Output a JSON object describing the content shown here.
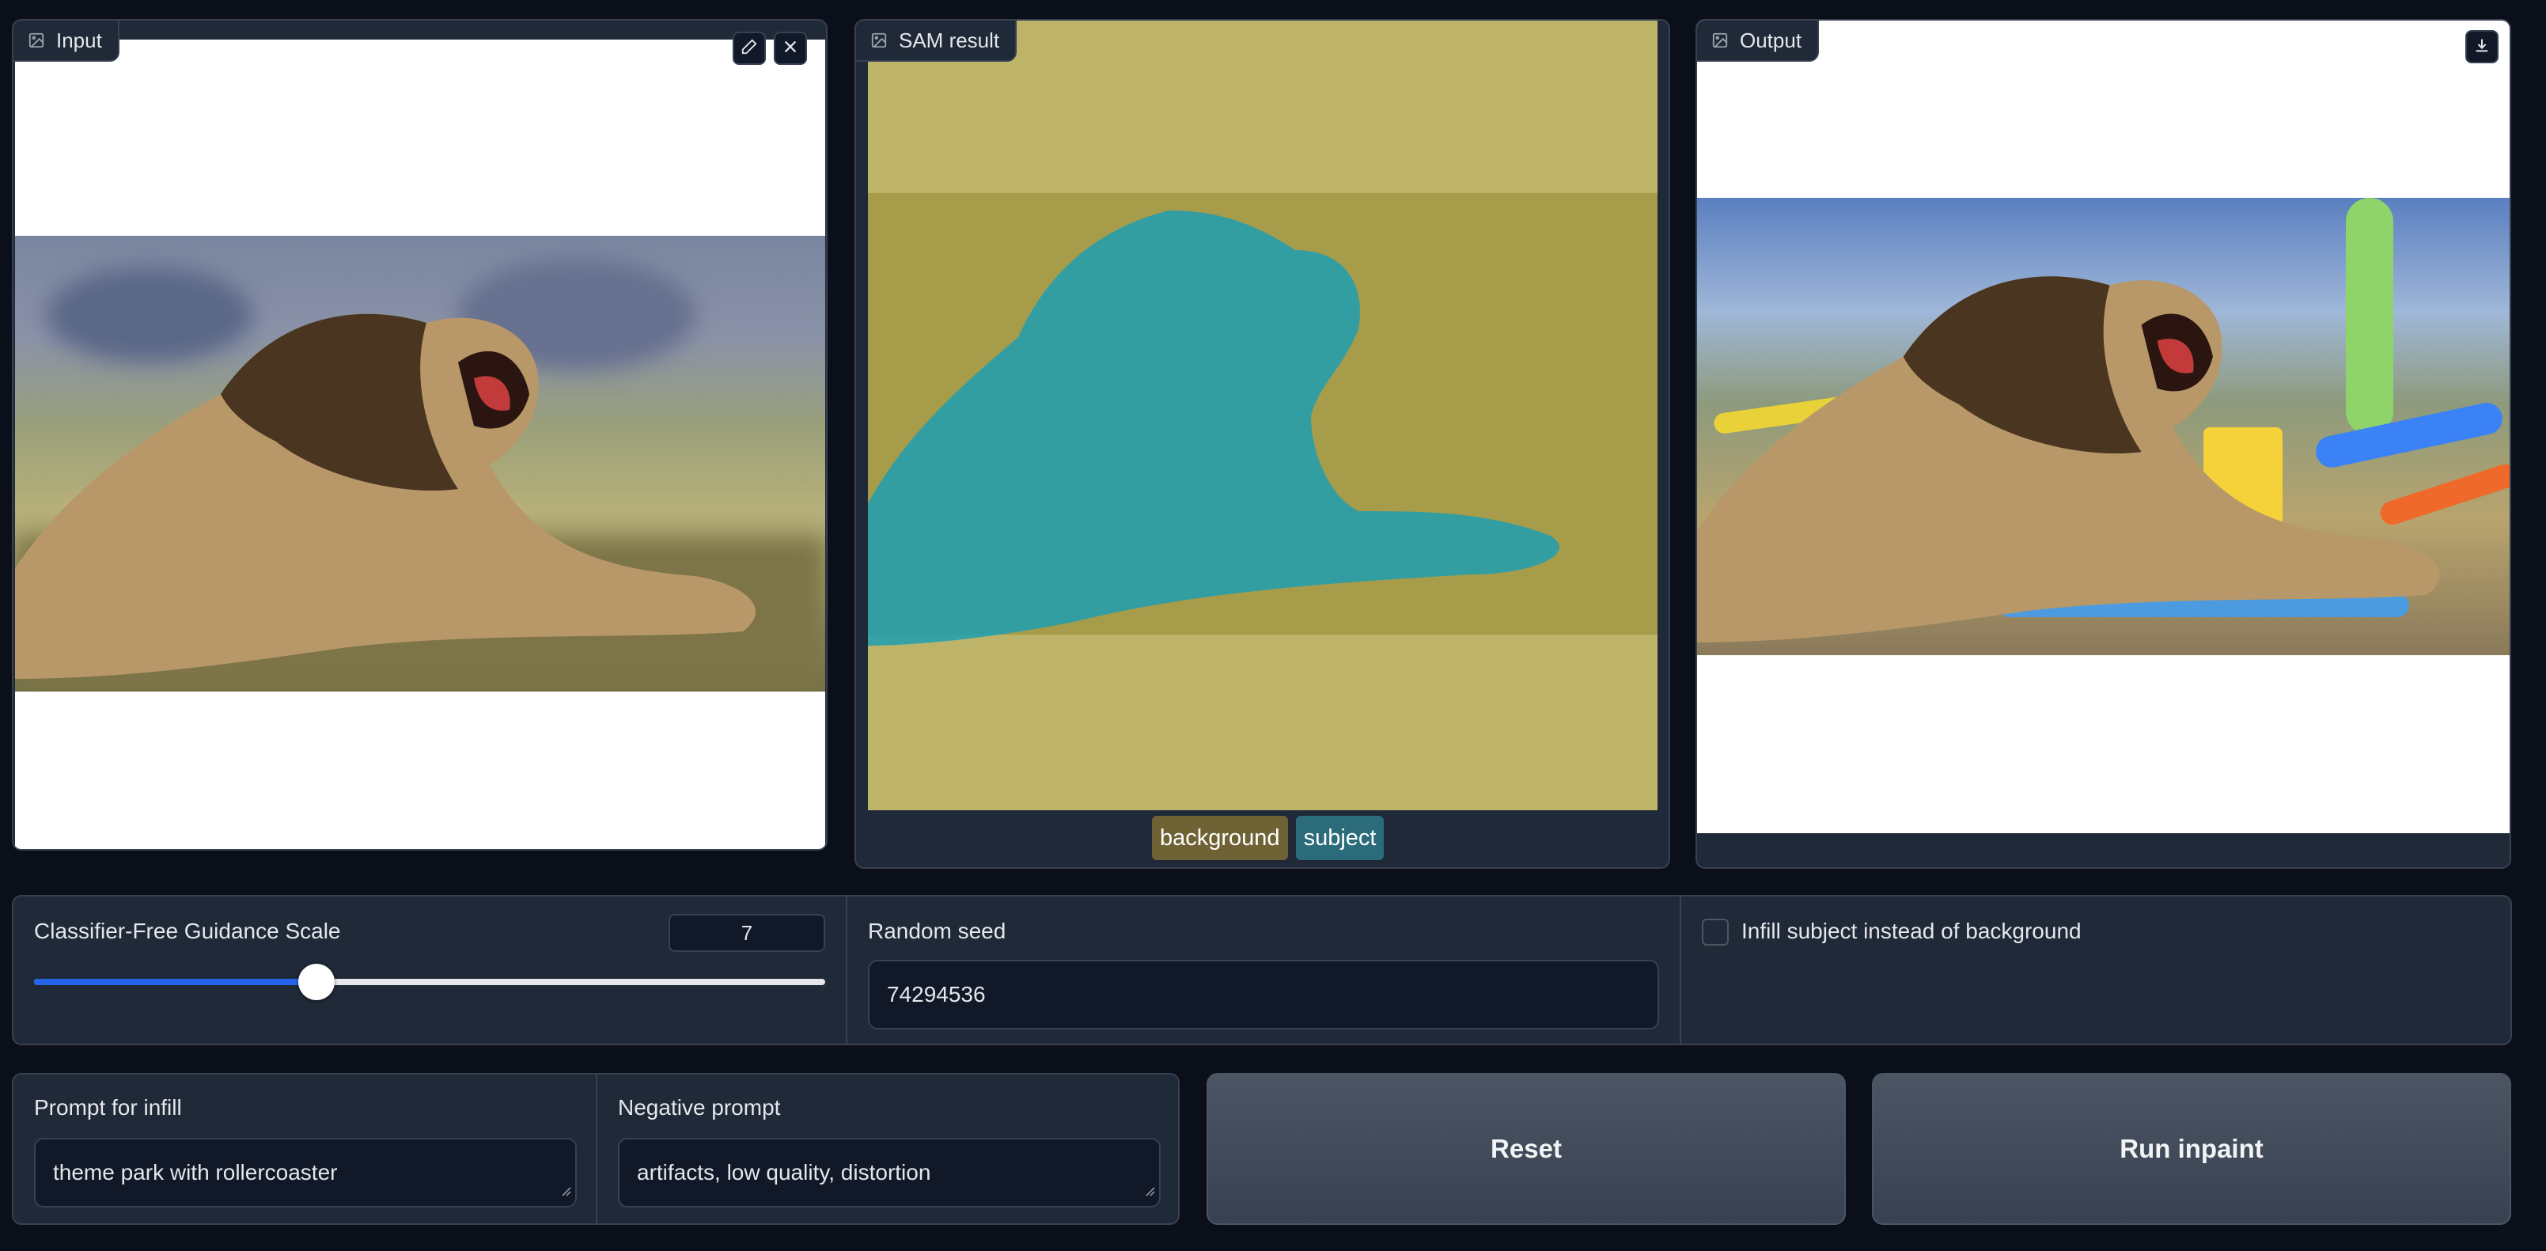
{
  "panels": {
    "input": {
      "label": "Input",
      "edit_icon": "pencil-icon",
      "clear_icon": "close-icon"
    },
    "sam": {
      "label": "SAM result",
      "legend": [
        {
          "label": "background",
          "color": "#6f6335"
        },
        {
          "label": "subject",
          "color": "#2b6b7a"
        }
      ]
    },
    "output": {
      "label": "Output",
      "download_icon": "download-icon"
    }
  },
  "colors": {
    "mask_background": "#bdb46a",
    "mask_subject": "#1f9fb0",
    "slider_fill": "#2563eb"
  },
  "settings": {
    "cfg": {
      "label": "Classifier-Free Guidance Scale",
      "value": "7",
      "slider_fraction": 0.357
    },
    "seed": {
      "label": "Random seed",
      "value": "74294536"
    },
    "infill_subject": {
      "label": "Infill subject instead of background",
      "checked": false
    }
  },
  "prompts": {
    "infill": {
      "label": "Prompt for infill",
      "value": "theme park with rollercoaster"
    },
    "negative": {
      "label": "Negative prompt",
      "value": "artifacts, low quality, distortion"
    }
  },
  "buttons": {
    "reset": "Reset",
    "run": "Run inpaint"
  }
}
